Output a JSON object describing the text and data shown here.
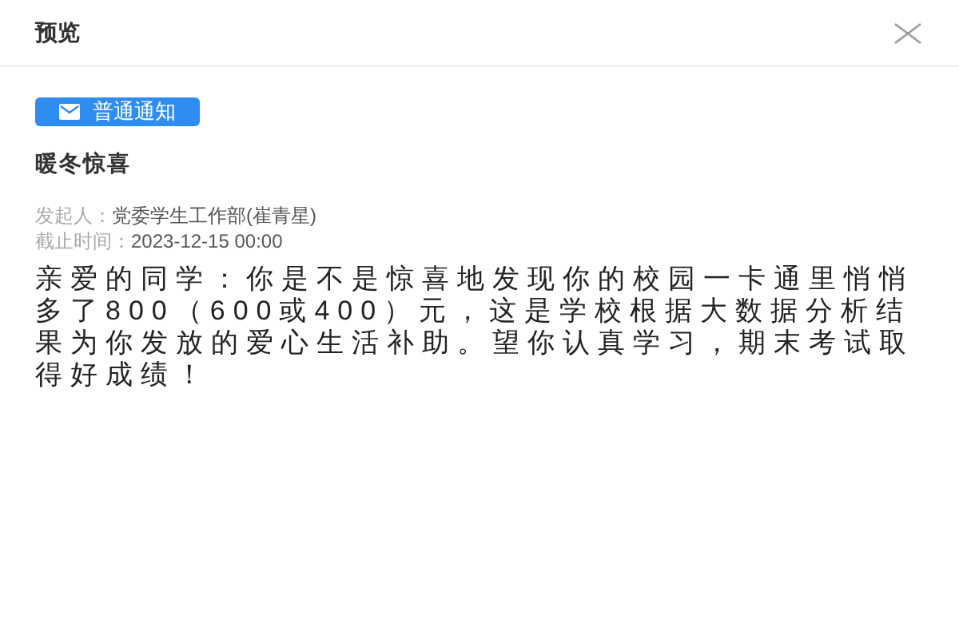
{
  "dialog": {
    "title": "预览"
  },
  "tag": {
    "label": "普通通知"
  },
  "notice": {
    "title": "暖冬惊喜",
    "meta": [
      {
        "label": "发起人：",
        "value": "党委学生工作部(崔青星)"
      },
      {
        "label": "截止时间：",
        "value": "2023-12-15 00:00"
      }
    ],
    "body": "亲爱的同学：你是不是惊喜地发现你的校园一卡通里悄悄多了800（600或400）元，这是学校根据大数据分析结果为你发放的爱心生活补助。望你认真学习，期末考试取得好成绩！"
  }
}
